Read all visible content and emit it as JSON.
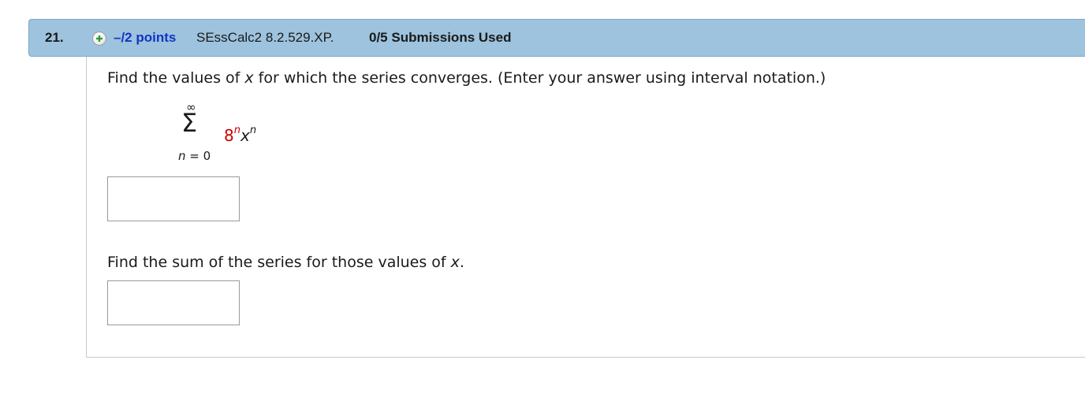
{
  "header": {
    "question_number": "21.",
    "points": "–/2 points",
    "source": "SEssCalc2 8.2.529.XP.",
    "submissions": "0/5 Submissions Used",
    "plus_icon": "plus-circle-icon",
    "background_color": "#9dc3de",
    "points_color": "#1433c4"
  },
  "question": {
    "prompt1_pre": "Find the values of ",
    "prompt1_var": "x",
    "prompt1_post": " for which the series converges. (Enter your answer using interval notation.)",
    "series": {
      "upper_limit": "∞",
      "sigma": "Σ",
      "index_var": "n",
      "index_eq": " = 0",
      "base": "8",
      "base_exp": "n",
      "var": "x",
      "var_exp": "n",
      "highlight_color": "#cc0000"
    },
    "answer1_value": "",
    "prompt2_pre": "Find the sum of the series for those values of ",
    "prompt2_var": "x",
    "prompt2_post": ".",
    "answer2_value": ""
  }
}
